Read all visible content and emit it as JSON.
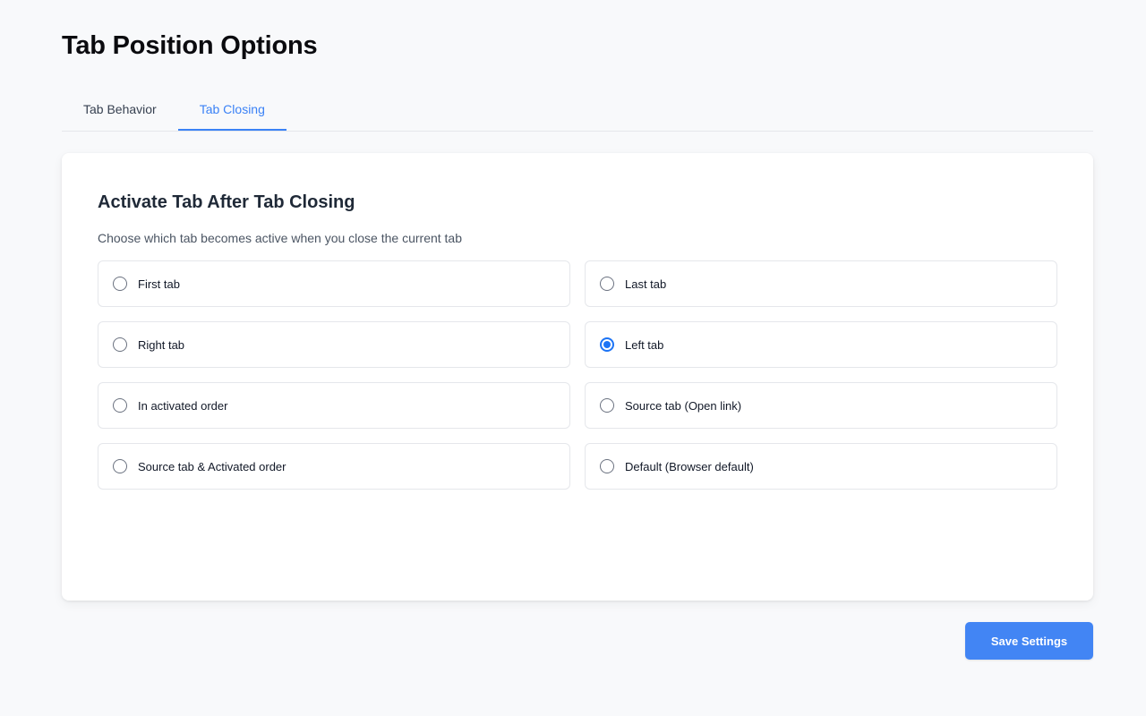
{
  "page": {
    "title": "Tab Position Options"
  },
  "tabs": [
    {
      "label": "Tab Behavior",
      "active": false
    },
    {
      "label": "Tab Closing",
      "active": true
    }
  ],
  "section": {
    "title": "Activate Tab After Tab Closing",
    "description": "Choose which tab becomes active when you close the current tab",
    "options": [
      {
        "label": "First tab",
        "checked": false
      },
      {
        "label": "Last tab",
        "checked": false
      },
      {
        "label": "Right tab",
        "checked": false
      },
      {
        "label": "Left tab",
        "checked": true
      },
      {
        "label": "In activated order",
        "checked": false
      },
      {
        "label": "Source tab (Open link)",
        "checked": false
      },
      {
        "label": "Source tab & Activated order",
        "checked": false
      },
      {
        "label": "Default (Browser default)",
        "checked": false
      }
    ]
  },
  "footer": {
    "save_label": "Save Settings"
  },
  "colors": {
    "accent": "#3b82f6",
    "button": "#4285f4",
    "background": "#f8f9fb"
  }
}
